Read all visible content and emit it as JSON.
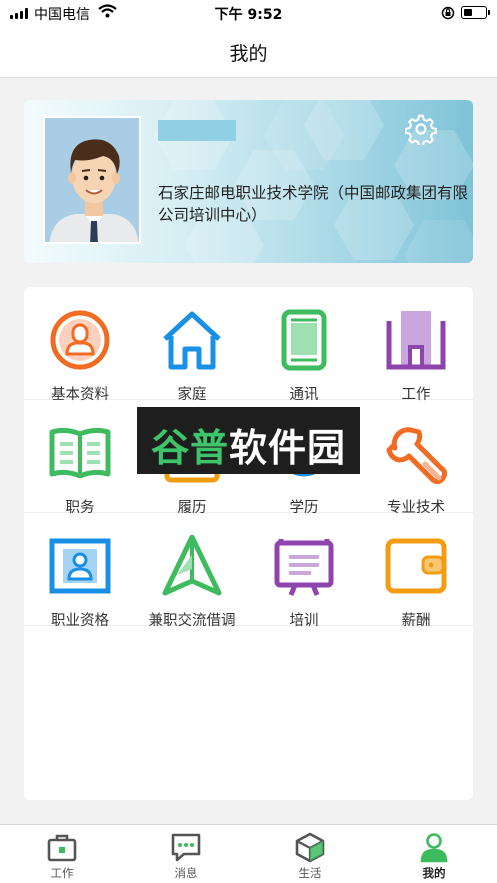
{
  "status_bar": {
    "carrier": "中国电信",
    "time": "下午 9:52"
  },
  "header": {
    "title": "我的"
  },
  "profile": {
    "name": "",
    "organization": "石家庄邮电职业技术学院（中国邮政集团有限公司培训中心）"
  },
  "menu": {
    "rows": [
      [
        {
          "label": "基本资料",
          "icon": "user-circle-icon",
          "color": "#f26b22"
        },
        {
          "label": "家庭",
          "icon": "home-icon",
          "color": "#1a8fe6"
        },
        {
          "label": "通讯",
          "icon": "phone-icon",
          "color": "#3dbb5e"
        },
        {
          "label": "工作",
          "icon": "building-icon",
          "color": "#8e44ad"
        }
      ],
      [
        {
          "label": "职务",
          "icon": "book-icon",
          "color": "#3dbb5e"
        },
        {
          "label": "履历",
          "icon": "resume-icon",
          "color": "#f39c12"
        },
        {
          "label": "学历",
          "icon": "graduation-icon",
          "color": "#1a8fe6"
        },
        {
          "label": "专业技术",
          "icon": "wrench-icon",
          "color": "#f26b22"
        }
      ],
      [
        {
          "label": "职业资格",
          "icon": "id-card-icon",
          "color": "#1a8fe6"
        },
        {
          "label": "兼职交流借调",
          "icon": "paper-plane-icon",
          "color": "#3dbb5e"
        },
        {
          "label": "培训",
          "icon": "presentation-board-icon",
          "color": "#8e44ad"
        },
        {
          "label": "薪酬",
          "icon": "wallet-icon",
          "color": "#f39c12"
        }
      ]
    ]
  },
  "watermark": {
    "text_green": "谷普",
    "text_white": "软件园"
  },
  "tabs": [
    {
      "label": "工作",
      "icon": "briefcase-icon",
      "active": false
    },
    {
      "label": "消息",
      "icon": "chat-bubble-icon",
      "active": false
    },
    {
      "label": "生活",
      "icon": "cube-icon",
      "active": false
    },
    {
      "label": "我的",
      "icon": "person-icon",
      "active": true
    }
  ],
  "colors": {
    "accent_green": "#3dbb5e",
    "tab_icon_gray": "#555555"
  }
}
